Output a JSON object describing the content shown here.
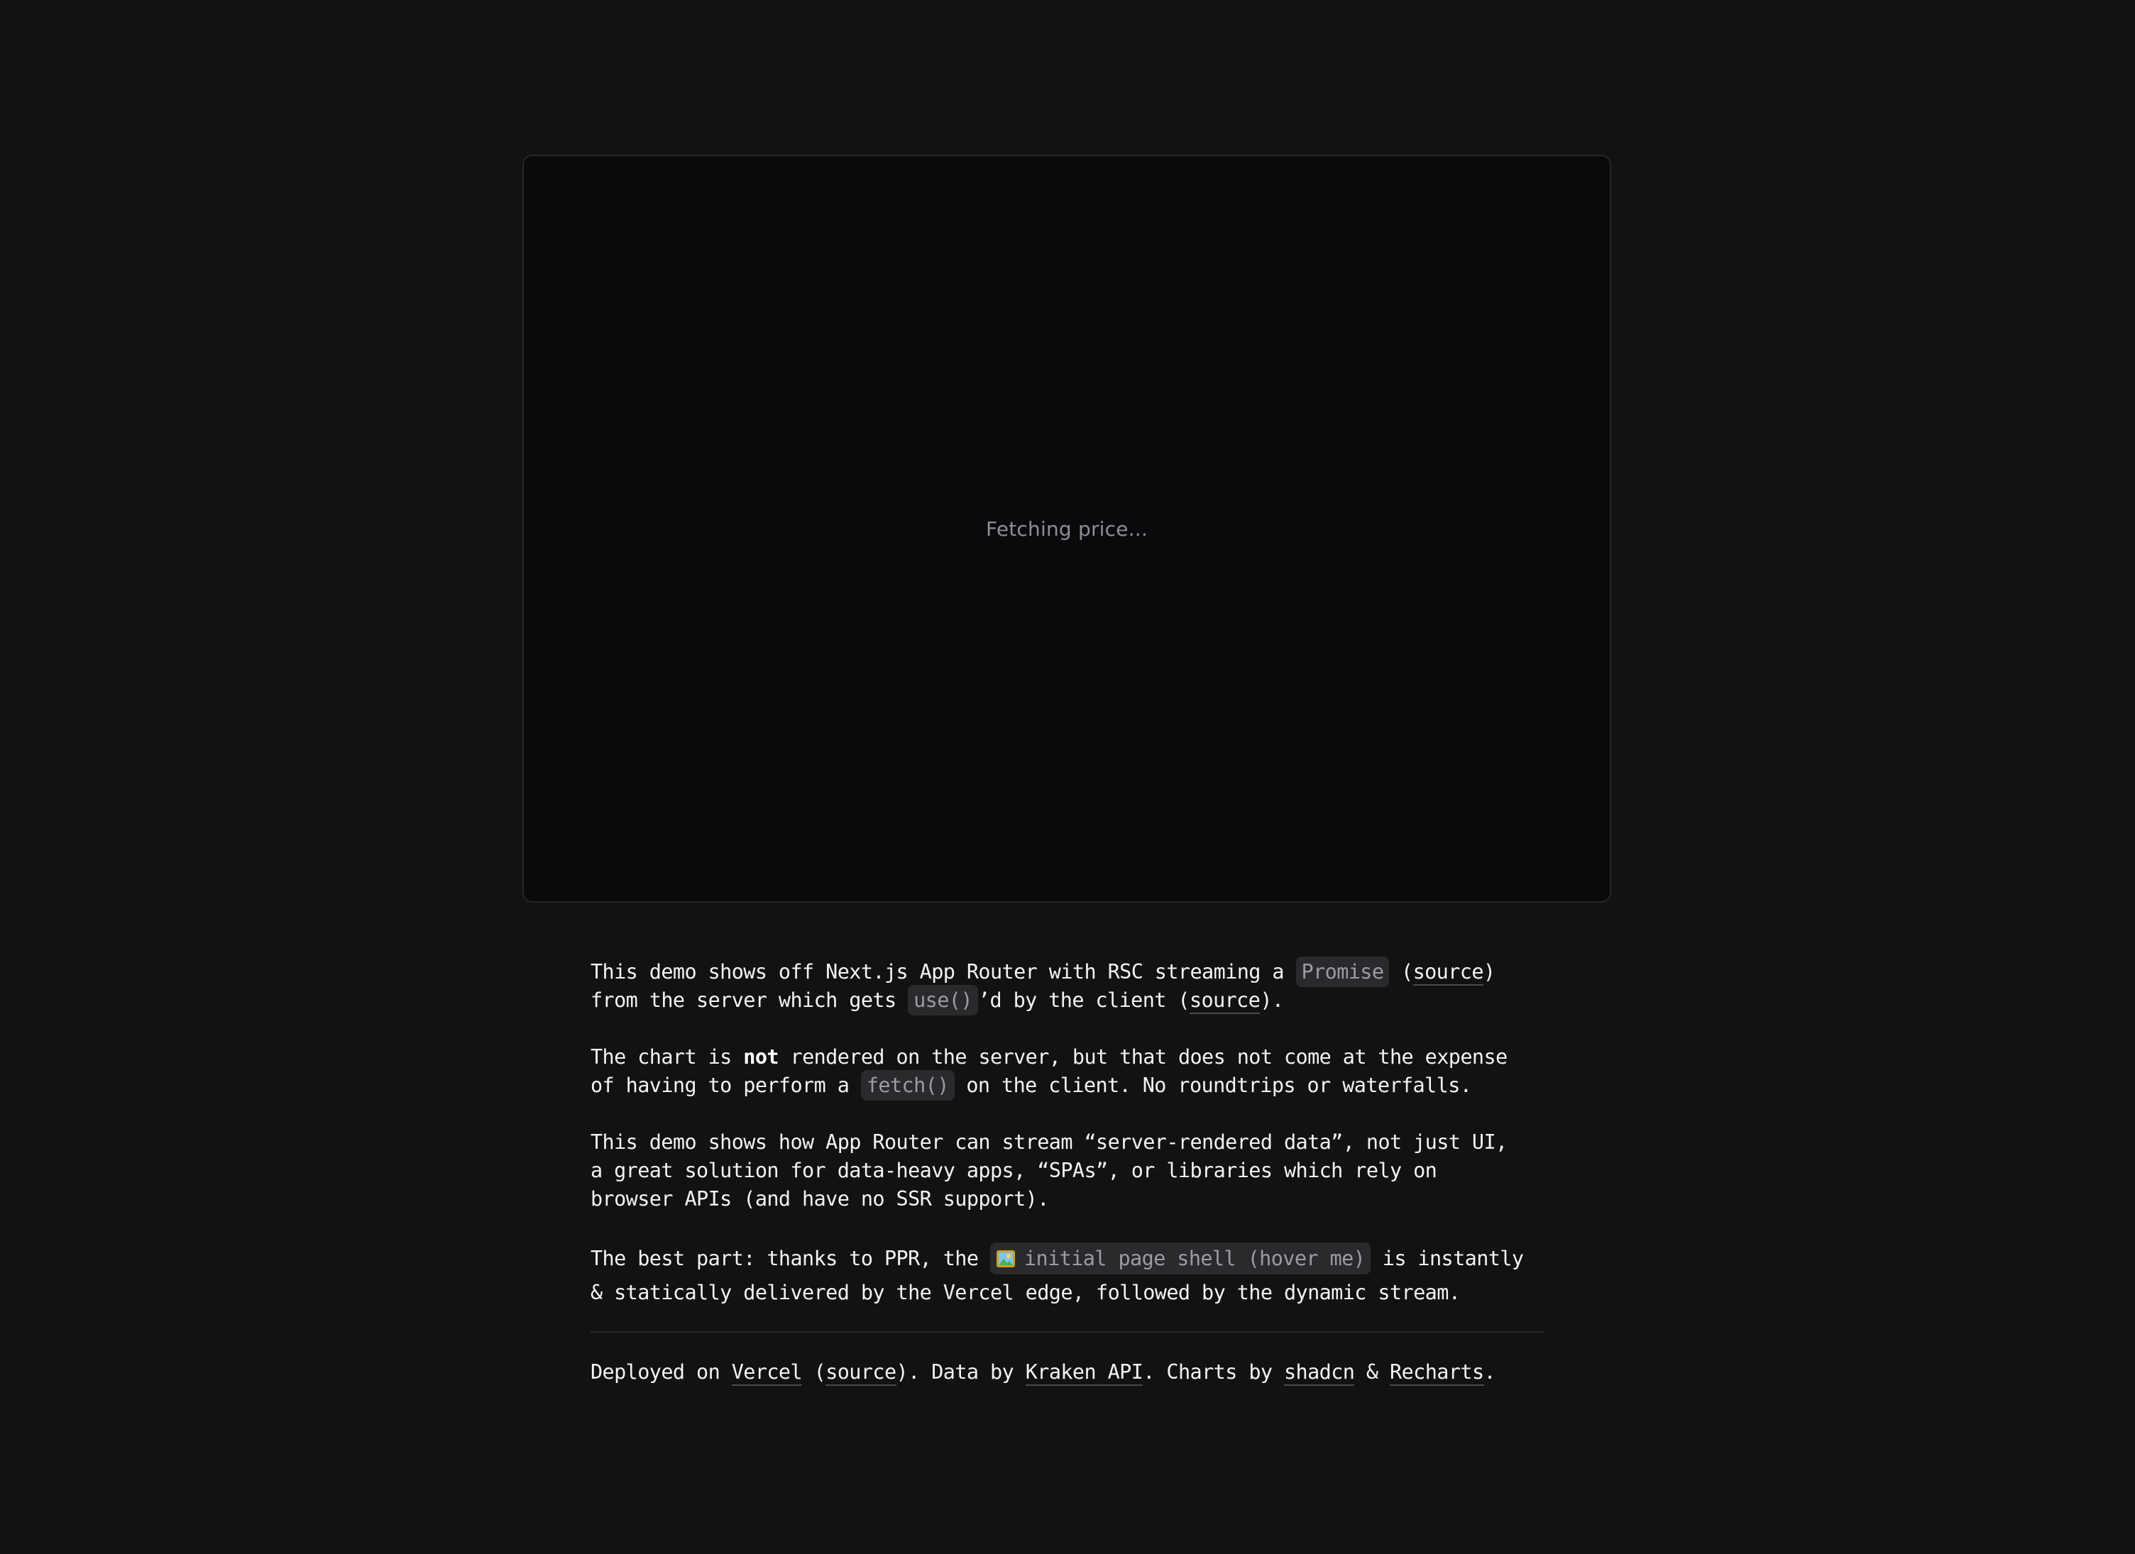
{
  "chart_card": {
    "loading_text": "Fetching price..."
  },
  "description": {
    "p1": {
      "l1_a": "This demo shows off Next.js App Router with RSC streaming a ",
      "code_promise": "Promise",
      "l1_b": " (",
      "link_source_1": "source",
      "l1_c": ")",
      "l2_a": "from the server which gets ",
      "code_use": "use()",
      "l2_b": "’d by the client (",
      "link_source_2": "source",
      "l2_c": ")."
    },
    "p2": {
      "l1_a": "The chart is ",
      "bold_not": "not",
      "l1_b": " rendered on the server, but that does not come at the expense",
      "l2_a": "of having to perform a ",
      "code_fetch": "fetch()",
      "l2_b": " on the client. No roundtrips or waterfalls."
    },
    "p3": {
      "l1": "This demo shows how App Router can stream “server-rendered data”, not just UI,",
      "l2": "a great solution for data-heavy apps, “SPAs”, or libraries which rely on",
      "l3": "browser APIs (and have no SSR support)."
    },
    "p4": {
      "l1_a": "The best part: thanks to PPR, the ",
      "shell_label": "initial page shell (hover me)",
      "l1_b": " is instantly",
      "l2": "& statically delivered by the Vercel edge, followed by the dynamic stream."
    }
  },
  "footer": {
    "a": "Deployed on ",
    "link_vercel": "Vercel",
    "b": " (",
    "link_source": "source",
    "c": "). Data by ",
    "link_kraken": "Kraken API",
    "d": ". Charts by ",
    "link_shadcn": "shadcn",
    "e": " & ",
    "link_recharts": "Recharts",
    "f": "."
  },
  "icons": {
    "shell_icon": "framed-picture-icon"
  },
  "colors": {
    "background": "#121212",
    "card_background": "#0a0a0c",
    "code_background": "#2a2a2d",
    "text": "#f3f3f3",
    "muted": "#8e8e95"
  }
}
